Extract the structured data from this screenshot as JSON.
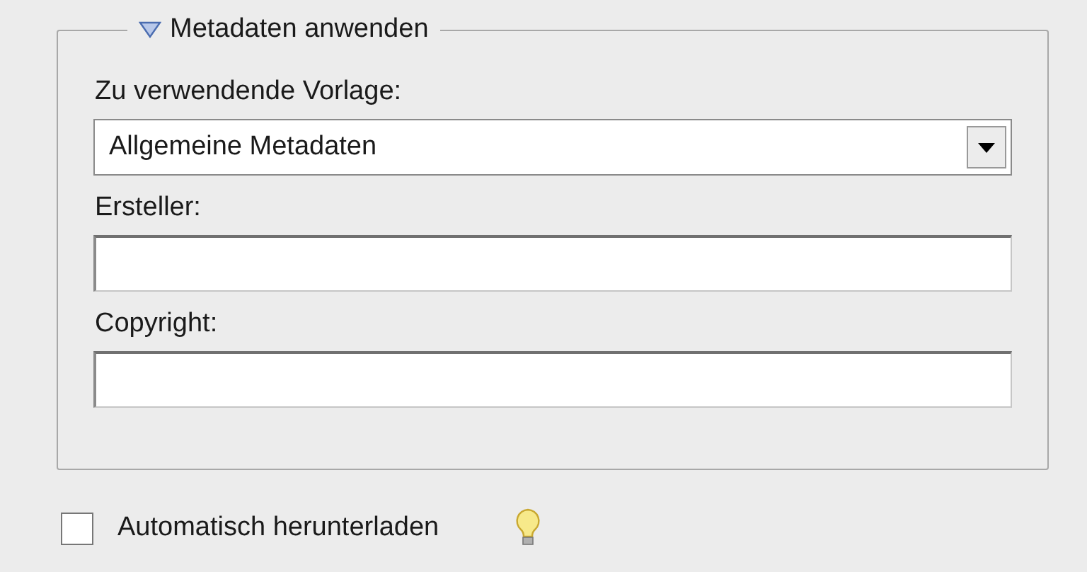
{
  "group": {
    "title": "Metadaten anwenden",
    "expanded": true
  },
  "template": {
    "label": "Zu verwendende Vorlage:",
    "value": "Allgemeine Metadaten"
  },
  "fields": [
    {
      "label": "Ersteller:"
    },
    {
      "label": "Copyright:"
    }
  ],
  "auto_download": {
    "label": "Automatisch herunterladen",
    "checked": false
  }
}
